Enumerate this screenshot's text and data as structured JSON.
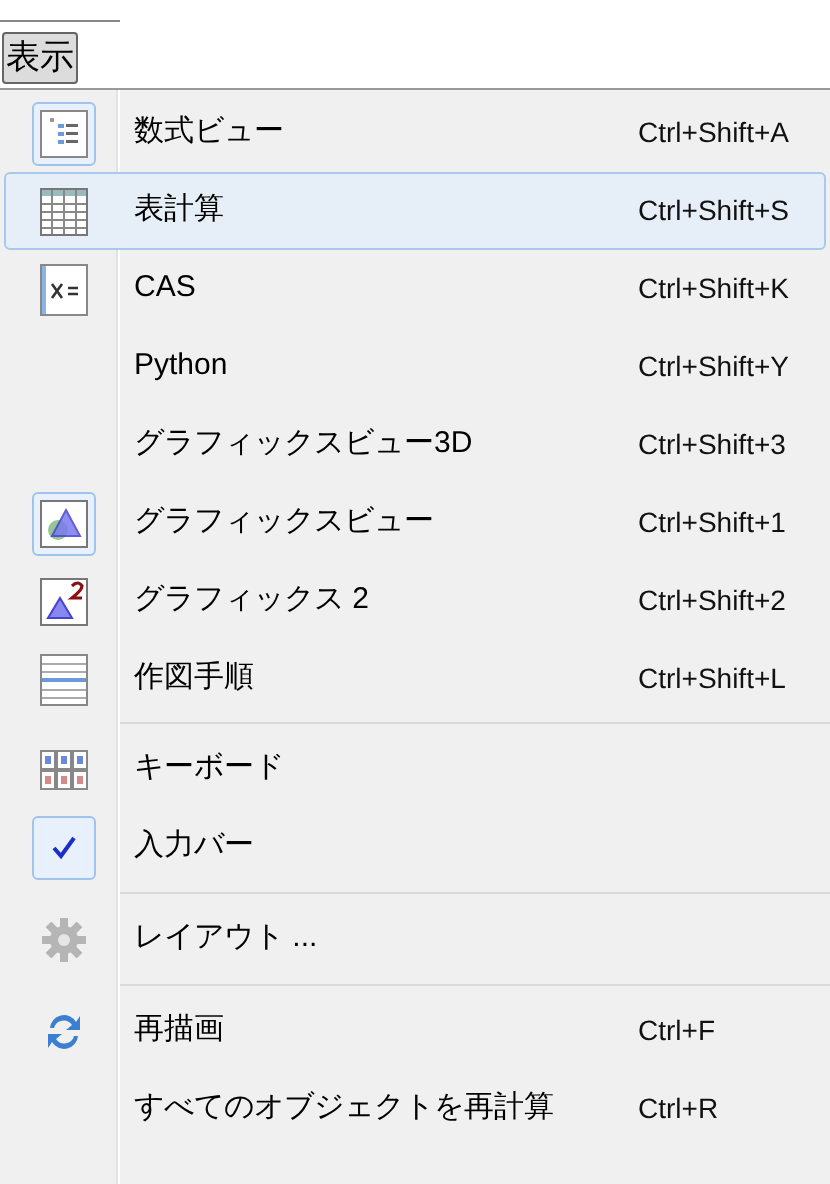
{
  "menu_title": "表示",
  "groups": [
    {
      "items": [
        {
          "label": "数式ビュー",
          "shortcut": "Ctrl+Shift+A",
          "checked": true,
          "selected": false
        },
        {
          "label": "表計算",
          "shortcut": "Ctrl+Shift+S",
          "checked": false,
          "selected": true
        },
        {
          "label": "CAS",
          "shortcut": "Ctrl+Shift+K",
          "checked": false,
          "selected": false
        },
        {
          "label": "Python",
          "shortcut": "Ctrl+Shift+Y",
          "checked": false,
          "selected": false
        },
        {
          "label": "グラフィックスビュー3D",
          "shortcut": "Ctrl+Shift+3",
          "checked": false,
          "selected": false
        },
        {
          "label": "グラフィックスビュー",
          "shortcut": "Ctrl+Shift+1",
          "checked": true,
          "selected": false
        },
        {
          "label": "グラフィックス 2",
          "shortcut": "Ctrl+Shift+2",
          "checked": false,
          "selected": false
        },
        {
          "label": "作図手順",
          "shortcut": "Ctrl+Shift+L",
          "checked": false,
          "selected": false
        }
      ]
    },
    {
      "items": [
        {
          "label": "キーボード",
          "checked": false,
          "selected": false
        },
        {
          "label": "入力バー",
          "checked": true,
          "selected": false
        }
      ]
    },
    {
      "items": [
        {
          "label": "レイアウト ...",
          "selected": false
        }
      ]
    },
    {
      "items": [
        {
          "label": "再描画",
          "shortcut": "Ctrl+F",
          "selected": false
        },
        {
          "label": "すべてのオブジェクトを再計算",
          "shortcut": "Ctrl+R",
          "selected": false
        }
      ]
    }
  ]
}
